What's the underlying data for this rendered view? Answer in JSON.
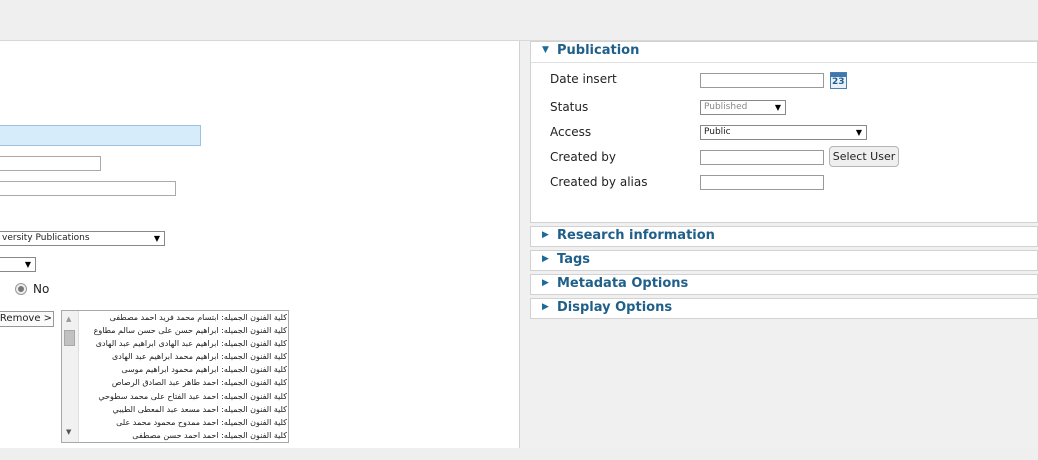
{
  "left": {
    "category_select": {
      "value": "versity Publications"
    },
    "radio_no": {
      "label": "No"
    },
    "remove_button": {
      "label": "Remove >"
    },
    "listbox_items": [
      "كلية الفنون الجميله: ابتسام محمد فريد احمد مصطفى",
      "كلية الفنون الجميله: ابراهيم حسن على حسن سالم مطاوع",
      "كلية الفنون الجميله: ابراهيم عبد الهادى ابراهيم عبد الهادى",
      "كلية الفنون الجميله: ابراهيم محمد ابراهيم عبد الهادى",
      "كلية الفنون الجميله: ابراهيم محمود ابراهيم موسى",
      "كلية الفنون الجميله: احمد طاهر عبد الصادق الرصاص",
      "كلية الفنون الجميله: احمد عبد الفتاح على محمد سطوحي",
      "كلية الفنون الجميله: احمد مسعد عبد المعطى الطيبي",
      "كلية الفنون الجميله: احمد ممدوح محمود محمد على",
      "كلية الفنون الجميله: احمد احمد حسن مصطفى"
    ]
  },
  "publication": {
    "title": "Publication",
    "date_insert_label": "Date insert",
    "calendar_number": "23",
    "status_label": "Status",
    "status_value": "Published",
    "access_label": "Access",
    "access_value": "Public",
    "created_by_label": "Created by",
    "select_user_label": "Select User",
    "created_by_alias_label": "Created by alias"
  },
  "panels": {
    "research": "Research information",
    "tags": "Tags",
    "metadata": "Metadata Options",
    "display": "Display Options"
  },
  "colors": {
    "panel_title": "#1f5f89",
    "title_field_bg": "#d7ecfb"
  }
}
